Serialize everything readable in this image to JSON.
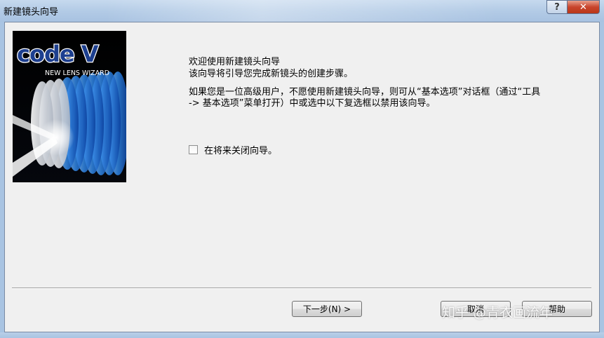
{
  "window": {
    "title": "新建镜头向导",
    "help_label": "?",
    "close_label": "✕"
  },
  "wizard_image": {
    "logo_text": "code V",
    "subtitle": "NEW LENS WIZARD"
  },
  "content": {
    "heading": "欢迎使用新建镜头向导",
    "intro": "该向导将引导您完成新镜头的创建步骤。",
    "advanced_note": "如果您是一位高级用户，不愿使用新建镜头向导，则可从“基本选项”对话框（通过“工具 -> 基本选项”菜单打开）中或选中以下复选框以禁用该向导。",
    "checkbox_label": "在将来关闭向导。",
    "checkbox_checked": false
  },
  "buttons": {
    "next": "下一步(N) >",
    "cancel": "取消",
    "help": "帮助"
  },
  "watermark": "知乎 @青衣画流年"
}
